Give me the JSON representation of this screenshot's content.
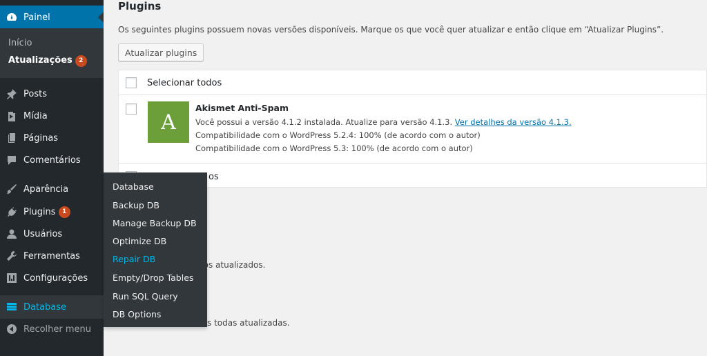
{
  "sidebar": {
    "painel": "Painel",
    "painel_sub": {
      "inicio": "Início",
      "atualizacoes": "Atualizações",
      "atualizacoes_count": "2"
    },
    "posts": "Posts",
    "midia": "Mídia",
    "paginas": "Páginas",
    "comentarios": "Comentários",
    "aparencia": "Aparência",
    "plugins": "Plugins",
    "plugins_count": "1",
    "usuarios": "Usuários",
    "ferramentas": "Ferramentas",
    "configuracoes": "Configurações",
    "database": "Database",
    "recolher": "Recolher menu"
  },
  "flyout": {
    "items": [
      "Database",
      "Backup DB",
      "Manage Backup DB",
      "Optimize DB",
      "Repair DB",
      "Empty/Drop Tables",
      "Run SQL Query",
      "DB Options"
    ],
    "hover_index": 4
  },
  "main": {
    "title": "Plugins",
    "description": "Os seguintes plugins possuem novas versões disponíveis. Marque os que você quer atualizar e então clique em “Atualizar Plugins”.",
    "update_button": "Atualizar plugins",
    "select_all": "Selecionar todos",
    "select_all_footer_partial": "os",
    "plugin": {
      "icon_letter": "A",
      "name": "Akismet Anti-Spam",
      "line1": "Você possui a versão 4.1.2 instalada. Atualize para versão 4.1.3. ",
      "line1_link": "Ver detalhes da versão 4.1.3.",
      "line2": "Compatibilidade com o WordPress 5.2.4: 100% (de acordo com o autor)",
      "line3": "Compatibilidade com o WordPress 5.3: 100% (de acordo com o autor)"
    },
    "themes_partial": "dos atualizados.",
    "translations_partial": "s todas atualizadas."
  },
  "colors": {
    "sidebar": "#23282d",
    "accent": "#0073aa",
    "badge": "#ca4a1f",
    "hover": "#00b9eb",
    "akismet": "#6c9f3a"
  }
}
